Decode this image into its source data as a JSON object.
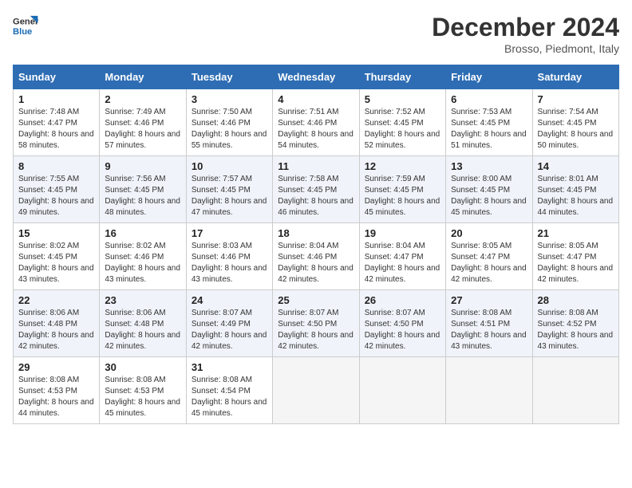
{
  "logo": {
    "line1": "General",
    "line2": "Blue"
  },
  "title": "December 2024",
  "location": "Brosso, Piedmont, Italy",
  "headers": [
    "Sunday",
    "Monday",
    "Tuesday",
    "Wednesday",
    "Thursday",
    "Friday",
    "Saturday"
  ],
  "weeks": [
    [
      {
        "day": "1",
        "sunrise": "7:48 AM",
        "sunset": "4:47 PM",
        "daylight": "8 hours and 58 minutes."
      },
      {
        "day": "2",
        "sunrise": "7:49 AM",
        "sunset": "4:46 PM",
        "daylight": "8 hours and 57 minutes."
      },
      {
        "day": "3",
        "sunrise": "7:50 AM",
        "sunset": "4:46 PM",
        "daylight": "8 hours and 55 minutes."
      },
      {
        "day": "4",
        "sunrise": "7:51 AM",
        "sunset": "4:46 PM",
        "daylight": "8 hours and 54 minutes."
      },
      {
        "day": "5",
        "sunrise": "7:52 AM",
        "sunset": "4:45 PM",
        "daylight": "8 hours and 52 minutes."
      },
      {
        "day": "6",
        "sunrise": "7:53 AM",
        "sunset": "4:45 PM",
        "daylight": "8 hours and 51 minutes."
      },
      {
        "day": "7",
        "sunrise": "7:54 AM",
        "sunset": "4:45 PM",
        "daylight": "8 hours and 50 minutes."
      }
    ],
    [
      {
        "day": "8",
        "sunrise": "7:55 AM",
        "sunset": "4:45 PM",
        "daylight": "8 hours and 49 minutes."
      },
      {
        "day": "9",
        "sunrise": "7:56 AM",
        "sunset": "4:45 PM",
        "daylight": "8 hours and 48 minutes."
      },
      {
        "day": "10",
        "sunrise": "7:57 AM",
        "sunset": "4:45 PM",
        "daylight": "8 hours and 47 minutes."
      },
      {
        "day": "11",
        "sunrise": "7:58 AM",
        "sunset": "4:45 PM",
        "daylight": "8 hours and 46 minutes."
      },
      {
        "day": "12",
        "sunrise": "7:59 AM",
        "sunset": "4:45 PM",
        "daylight": "8 hours and 45 minutes."
      },
      {
        "day": "13",
        "sunrise": "8:00 AM",
        "sunset": "4:45 PM",
        "daylight": "8 hours and 45 minutes."
      },
      {
        "day": "14",
        "sunrise": "8:01 AM",
        "sunset": "4:45 PM",
        "daylight": "8 hours and 44 minutes."
      }
    ],
    [
      {
        "day": "15",
        "sunrise": "8:02 AM",
        "sunset": "4:45 PM",
        "daylight": "8 hours and 43 minutes."
      },
      {
        "day": "16",
        "sunrise": "8:02 AM",
        "sunset": "4:46 PM",
        "daylight": "8 hours and 43 minutes."
      },
      {
        "day": "17",
        "sunrise": "8:03 AM",
        "sunset": "4:46 PM",
        "daylight": "8 hours and 43 minutes."
      },
      {
        "day": "18",
        "sunrise": "8:04 AM",
        "sunset": "4:46 PM",
        "daylight": "8 hours and 42 minutes."
      },
      {
        "day": "19",
        "sunrise": "8:04 AM",
        "sunset": "4:47 PM",
        "daylight": "8 hours and 42 minutes."
      },
      {
        "day": "20",
        "sunrise": "8:05 AM",
        "sunset": "4:47 PM",
        "daylight": "8 hours and 42 minutes."
      },
      {
        "day": "21",
        "sunrise": "8:05 AM",
        "sunset": "4:47 PM",
        "daylight": "8 hours and 42 minutes."
      }
    ],
    [
      {
        "day": "22",
        "sunrise": "8:06 AM",
        "sunset": "4:48 PM",
        "daylight": "8 hours and 42 minutes."
      },
      {
        "day": "23",
        "sunrise": "8:06 AM",
        "sunset": "4:48 PM",
        "daylight": "8 hours and 42 minutes."
      },
      {
        "day": "24",
        "sunrise": "8:07 AM",
        "sunset": "4:49 PM",
        "daylight": "8 hours and 42 minutes."
      },
      {
        "day": "25",
        "sunrise": "8:07 AM",
        "sunset": "4:50 PM",
        "daylight": "8 hours and 42 minutes."
      },
      {
        "day": "26",
        "sunrise": "8:07 AM",
        "sunset": "4:50 PM",
        "daylight": "8 hours and 42 minutes."
      },
      {
        "day": "27",
        "sunrise": "8:08 AM",
        "sunset": "4:51 PM",
        "daylight": "8 hours and 43 minutes."
      },
      {
        "day": "28",
        "sunrise": "8:08 AM",
        "sunset": "4:52 PM",
        "daylight": "8 hours and 43 minutes."
      }
    ],
    [
      {
        "day": "29",
        "sunrise": "8:08 AM",
        "sunset": "4:53 PM",
        "daylight": "8 hours and 44 minutes."
      },
      {
        "day": "30",
        "sunrise": "8:08 AM",
        "sunset": "4:53 PM",
        "daylight": "8 hours and 45 minutes."
      },
      {
        "day": "31",
        "sunrise": "8:08 AM",
        "sunset": "4:54 PM",
        "daylight": "8 hours and 45 minutes."
      },
      null,
      null,
      null,
      null
    ]
  ],
  "labels": {
    "sunrise": "Sunrise:",
    "sunset": "Sunset:",
    "daylight": "Daylight:"
  },
  "colors": {
    "header_bg": "#2e6db4",
    "even_row": "#f0f4fa"
  }
}
